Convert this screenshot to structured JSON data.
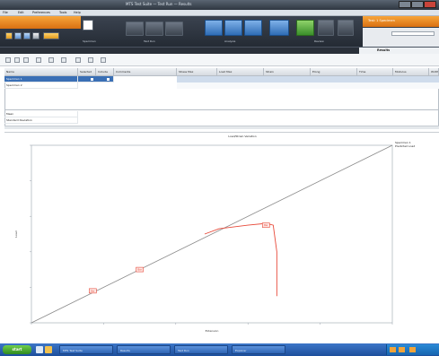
{
  "window": {
    "title": "MTS Test Suite — Test Run — Results"
  },
  "menubar": {
    "items": [
      "File",
      "Edit",
      "Preferences",
      "Tools",
      "Help"
    ]
  },
  "ribbon": {
    "right_title": "Test: 1 Specimen",
    "groups": [
      "Specimen",
      "Test Run",
      "Analysis",
      "Review"
    ],
    "results_tab": "Results"
  },
  "table": {
    "columns": [
      "Name",
      "Selected",
      "Include",
      "Comments",
      "Stress Max",
      "Load Max",
      "Strain",
      "Elong",
      "Time",
      "Modulus",
      "Width"
    ],
    "rows": [
      {
        "name": "Specimen 1",
        "selected": true
      },
      {
        "name": "Specimen 2",
        "selected": false
      }
    ],
    "stats": [
      {
        "label": "Mean"
      },
      {
        "label": "Standard Deviation"
      }
    ]
  },
  "chart_data": {
    "type": "line",
    "title": "Load/Strain Variation",
    "xlabel": "Extension",
    "ylabel": "Load",
    "legend": [
      "Specimen 1",
      "Predicted Load"
    ],
    "series": [
      {
        "name": "Reference",
        "x": [
          0,
          1
        ],
        "y": [
          0,
          1
        ]
      },
      {
        "name": "Specimen 1",
        "x": [
          0.48,
          0.52,
          0.6,
          0.65,
          0.67,
          0.68,
          0.68
        ],
        "y": [
          0.5,
          0.53,
          0.55,
          0.56,
          0.55,
          0.4,
          0.15
        ]
      }
    ],
    "markers": [
      {
        "x": 0.17,
        "y": 0.18,
        "label": "Bar"
      },
      {
        "x": 0.3,
        "y": 0.3,
        "label": "Bar"
      },
      {
        "x": 0.65,
        "y": 0.55,
        "label": "Bar"
      }
    ],
    "xlim": [
      0,
      1
    ],
    "ylim": [
      0,
      1
    ],
    "grid": false
  },
  "taskbar": {
    "start_label": "start",
    "tasks": [
      "MTS Test Suite",
      "Results",
      "Test Run",
      "Explorer"
    ]
  },
  "colors": {
    "accent": "#f08a24",
    "selection": "#3a6fb5",
    "series": "#e84a3a",
    "reference": "#888888"
  }
}
